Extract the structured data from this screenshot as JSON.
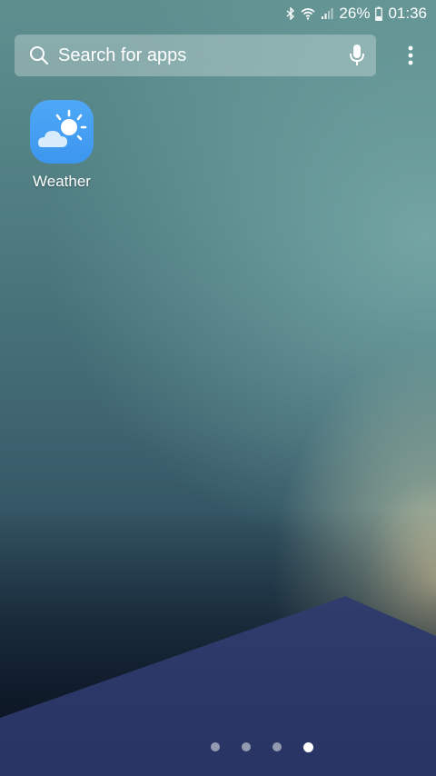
{
  "status_bar": {
    "battery_percent": "26%",
    "time": "01:36",
    "icons": [
      "bluetooth-icon",
      "wifi-icon",
      "signal-icon",
      "battery-icon"
    ]
  },
  "search": {
    "placeholder": "Search for apps",
    "icons": [
      "search-icon",
      "microphone-icon"
    ]
  },
  "menu": {
    "icon": "more-vertical-icon"
  },
  "apps": [
    {
      "label": "Weather",
      "icon": "weather-icon",
      "color": "#4ea8f6"
    }
  ],
  "pager": {
    "total_pages": 4,
    "current_page": 4
  }
}
